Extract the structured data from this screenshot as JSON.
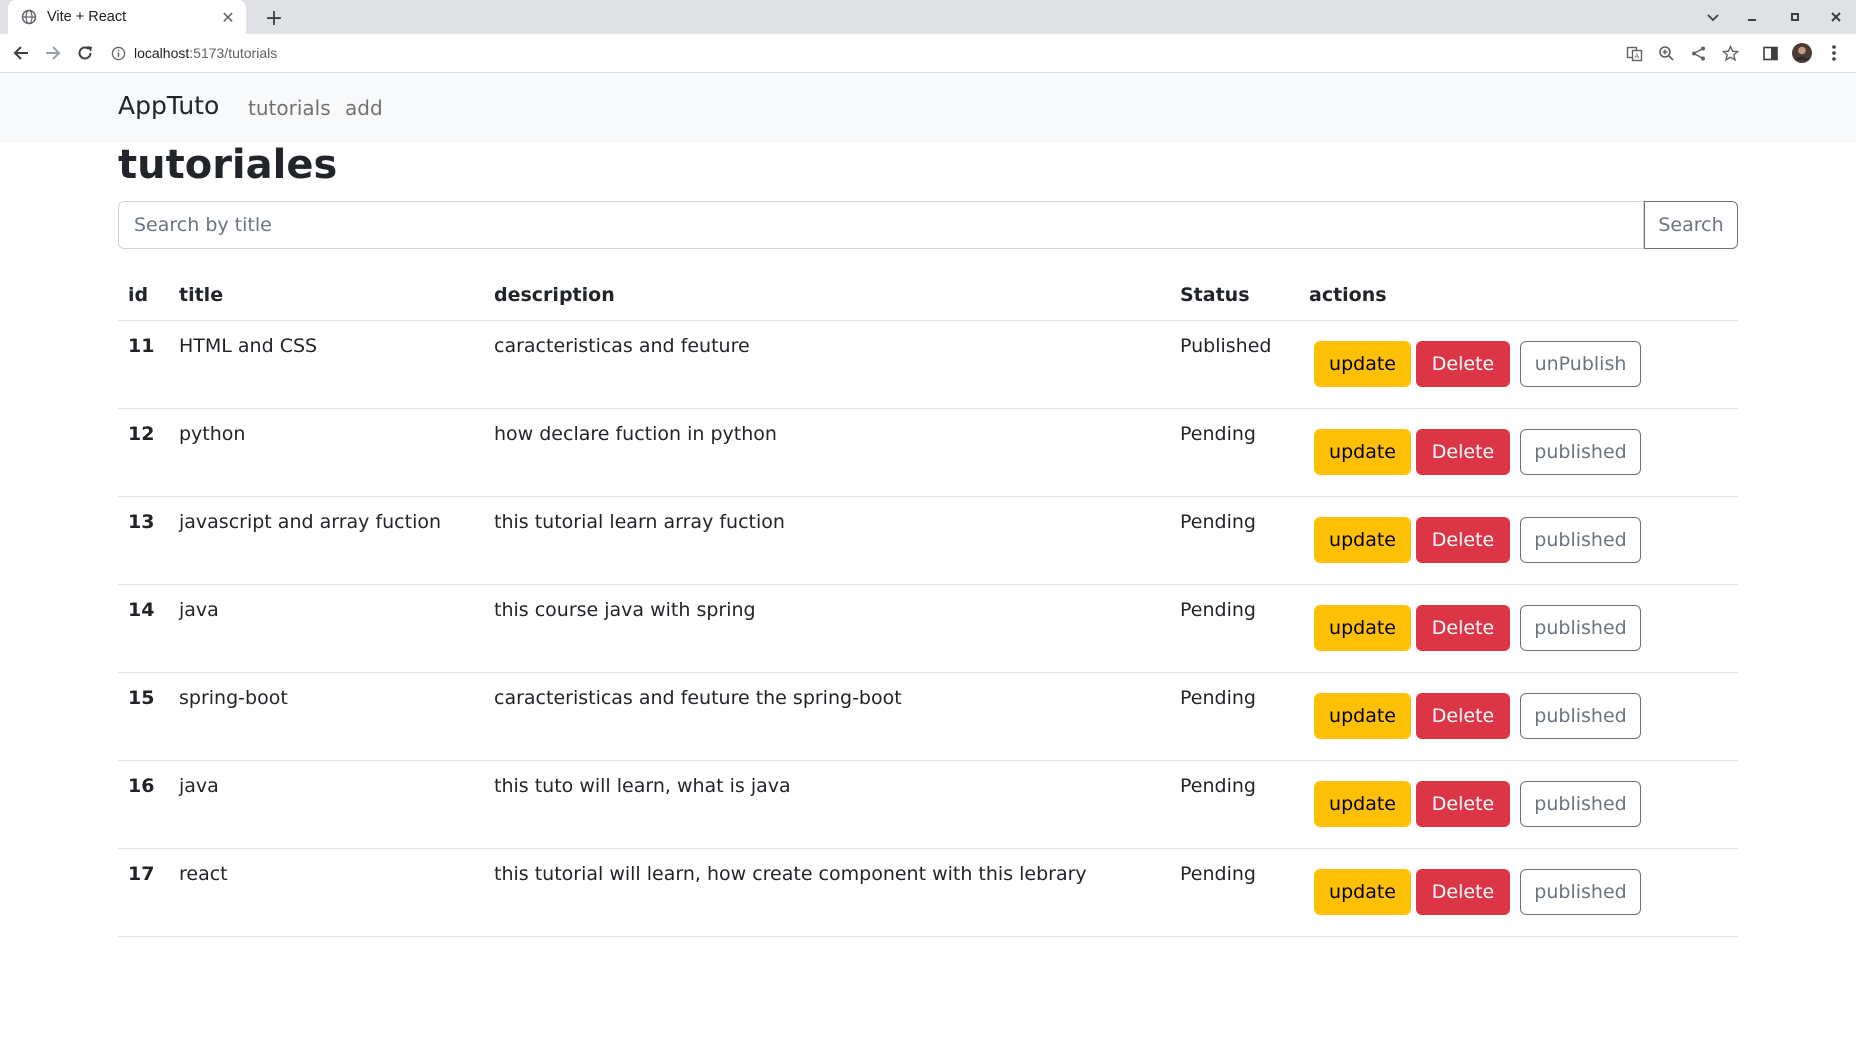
{
  "browser": {
    "tab_title": "Vite + React",
    "url_host": "localhost",
    "url_path": ":5173/tutorials"
  },
  "navbar": {
    "brand": "AppTuto",
    "links": [
      "tutorials",
      "add"
    ]
  },
  "page": {
    "title": "tutoriales",
    "search_placeholder": "Search by title",
    "search_button": "Search"
  },
  "table": {
    "headers": [
      "id",
      "title",
      "description",
      "Status",
      "actions"
    ],
    "action_labels": {
      "update": "update",
      "delete": "Delete"
    },
    "rows": [
      {
        "id": "11",
        "title": "HTML and CSS",
        "description": "caracteristicas and feuture",
        "status": "Published",
        "toggle": "unPublish"
      },
      {
        "id": "12",
        "title": "python",
        "description": "how declare fuction in python",
        "status": "Pending",
        "toggle": "published"
      },
      {
        "id": "13",
        "title": "javascript and array fuction",
        "description": "this tutorial learn array fuction",
        "status": "Pending",
        "toggle": "published"
      },
      {
        "id": "14",
        "title": "java",
        "description": "this course java with spring",
        "status": "Pending",
        "toggle": "published"
      },
      {
        "id": "15",
        "title": "spring-boot",
        "description": "caracteristicas and feuture the spring-boot",
        "status": "Pending",
        "toggle": "published"
      },
      {
        "id": "16",
        "title": "java",
        "description": "this tuto will learn, what is java",
        "status": "Pending",
        "toggle": "published"
      },
      {
        "id": "17",
        "title": "react",
        "description": "this tutorial will learn, how create component with this lebrary",
        "status": "Pending",
        "toggle": "published"
      }
    ]
  },
  "colors": {
    "warning": "#ffc107",
    "danger": "#dc3545",
    "secondary": "#6c757d",
    "navbar_bg": "#f8f9fa"
  }
}
